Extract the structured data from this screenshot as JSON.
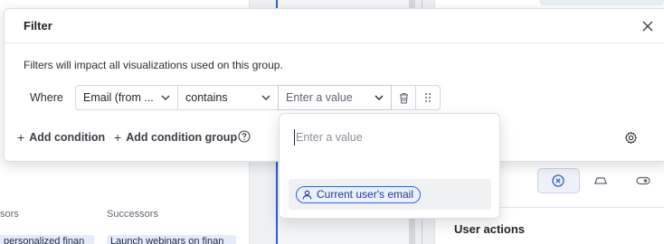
{
  "background": {
    "columns": {
      "predecessors_header": "sors",
      "successors_header": "Successors"
    },
    "chips": {
      "left_chip": "personalized finan",
      "right_chip": "Launch webinars on finan"
    },
    "right_panel": {
      "user_actions_title": "User actions",
      "view_toggle": [
        "x-circle-icon",
        "rectangle-icon",
        "toggle-icon"
      ]
    }
  },
  "filter_modal": {
    "title": "Filter",
    "description": "Filters will impact all visualizations used on this group.",
    "where_label": "Where",
    "field_select": "Email (from ...",
    "operator_select": "contains",
    "value_select_placeholder": "Enter a value",
    "add_condition_label": "Add condition",
    "add_condition_group_label": "Add condition group",
    "plus_symbol": "+"
  },
  "value_dropdown": {
    "search_placeholder": "Enter a value",
    "option_current_user_email": "Current user's email"
  },
  "colors": {
    "accent": "#2f5fd0",
    "chip_border": "#3a63c9",
    "chip_bg": "#eaf0fc"
  }
}
